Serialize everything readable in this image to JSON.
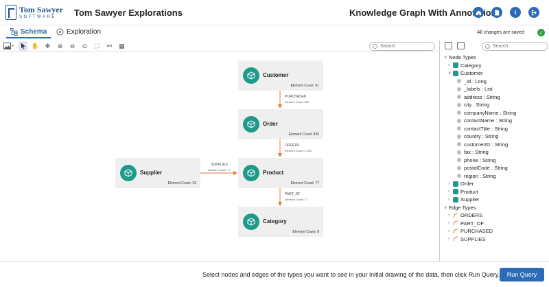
{
  "header": {
    "logo_line1": "Tom Sawyer",
    "logo_line2": "SOFTWARE",
    "app_title": "Tom Sawyer Explorations",
    "kg_title": "Knowledge Graph With Annotations"
  },
  "tabs": [
    {
      "label": "Schema",
      "icon": "schema-icon",
      "active": true
    },
    {
      "label": "Exploration",
      "icon": "compass-icon",
      "active": false
    }
  ],
  "status": {
    "saved": "All changes are saved"
  },
  "canvas_search": {
    "placeholder": "Search"
  },
  "panel_search": {
    "placeholder": "Search"
  },
  "nodes": {
    "customer": {
      "name": "Customer",
      "count": "Element Count: 91"
    },
    "order": {
      "name": "Order",
      "count": "Element Count: 830"
    },
    "product": {
      "name": "Product",
      "count": "Element Count: 77"
    },
    "supplier": {
      "name": "Supplier",
      "count": "Element Count: 29"
    },
    "category": {
      "name": "Category",
      "count": "Element Count: 8"
    }
  },
  "edges": {
    "purchased": {
      "name": "PURCHASED",
      "count": "Element Count: 830"
    },
    "orders": {
      "name": "ORDERS",
      "count": "Element Count: 2,155"
    },
    "supplies": {
      "name": "SUPPLIES",
      "count": "Element Count: 77"
    },
    "part_of": {
      "name": "PART_OF",
      "count": "Element Count: 77"
    }
  },
  "tree": {
    "node_types": "Node Types",
    "category": "Category",
    "customer": "Customer",
    "customer_props": [
      "_id : Long",
      "_labels : List",
      "address : String",
      "city : String",
      "companyName : String",
      "contactName : String",
      "contactTitle : String",
      "country : String",
      "customerID : String",
      "fax : String",
      "phone : String",
      "postalCode : String",
      "region : String"
    ],
    "order": "Order",
    "product": "Product",
    "supplier": "Supplier",
    "edge_types": "Edge Types",
    "edge_items": [
      "ORDERS",
      "PART_OF",
      "PURCHASED",
      "SUPPLIES"
    ]
  },
  "footer": {
    "message": "Select nodes and edges of the types you want to see in your initial drawing of the data, then click Run Query.",
    "run_label": "Run Query"
  },
  "colors": {
    "accent": "#2b6bb8",
    "node_icon": "#1f9a8a",
    "edge": "#e8763a"
  }
}
